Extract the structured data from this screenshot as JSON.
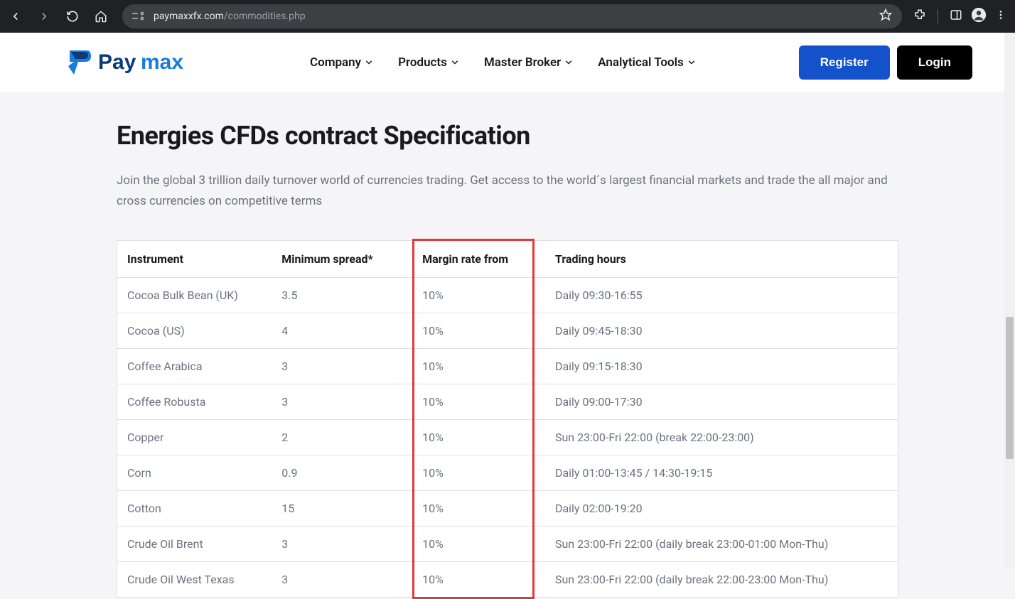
{
  "browser": {
    "url_host": "paymaxxfx.com",
    "url_path": "/commodities.php"
  },
  "logo_text": "Paymax",
  "nav": {
    "items": [
      "Company",
      "Products",
      "Master Broker",
      "Analytical Tools"
    ],
    "register": "Register",
    "login": "Login"
  },
  "page": {
    "title": "Energies CFDs contract Specification",
    "desc": "Join the global 3 trillion daily turnover world of currencies trading. Get access to the world´s largest financial markets and trade the all major and cross currencies on competitive terms"
  },
  "table": {
    "headers": {
      "instrument": "Instrument",
      "spread": "Minimum spread*",
      "margin": "Margin rate from",
      "hours": "Trading hours"
    },
    "rows": [
      {
        "instrument": "Cocoa Bulk Bean (UK)",
        "spread": "3.5",
        "margin": "10%",
        "hours": "Daily 09:30-16:55"
      },
      {
        "instrument": "Cocoa (US)",
        "spread": "4",
        "margin": "10%",
        "hours": "Daily 09:45-18:30"
      },
      {
        "instrument": "Coffee Arabica",
        "spread": "3",
        "margin": "10%",
        "hours": "Daily 09:15-18:30"
      },
      {
        "instrument": "Coffee Robusta",
        "spread": "3",
        "margin": "10%",
        "hours": "Daily 09:00-17:30"
      },
      {
        "instrument": "Copper",
        "spread": "2",
        "margin": "10%",
        "hours": "Sun 23:00-Fri 22:00 (break 22:00-23:00)"
      },
      {
        "instrument": "Corn",
        "spread": "0.9",
        "margin": "10%",
        "hours": "Daily 01:00-13:45 / 14:30-19:15"
      },
      {
        "instrument": "Cotton",
        "spread": "15",
        "margin": "10%",
        "hours": "Daily 02:00-19:20"
      },
      {
        "instrument": "Crude Oil Brent",
        "spread": "3",
        "margin": "10%",
        "hours": "Sun 23:00-Fri 22:00 (daily break 23:00-01:00 Mon-Thu)"
      },
      {
        "instrument": "Crude Oil West Texas",
        "spread": "3",
        "margin": "10%",
        "hours": "Sun 23:00-Fri 22:00 (daily break 22:00-23:00 Mon-Thu)"
      }
    ]
  }
}
